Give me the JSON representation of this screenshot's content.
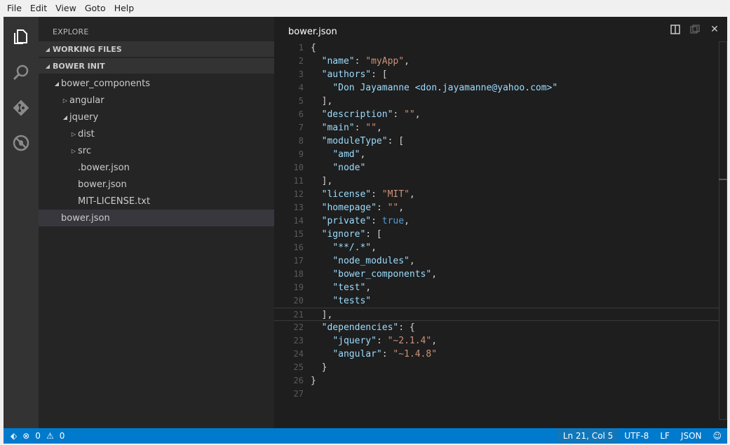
{
  "menu": [
    "File",
    "Edit",
    "View",
    "Goto",
    "Help"
  ],
  "activity": [
    {
      "icon": "files-icon"
    },
    {
      "icon": "search-icon"
    },
    {
      "icon": "git-icon"
    },
    {
      "icon": "debug-icon"
    }
  ],
  "sidebar": {
    "title": "EXPLORE",
    "sections": [
      "WORKING FILES",
      "BOWER INIT"
    ],
    "tree": [
      {
        "label": "bower_components",
        "twisty": "open"
      },
      {
        "label": "angular",
        "twisty": "closed"
      },
      {
        "label": "jquery",
        "twisty": "open"
      },
      {
        "label": "dist",
        "twisty": "closed"
      },
      {
        "label": "src",
        "twisty": "closed"
      },
      {
        "label": ".bower.json",
        "twisty": ""
      },
      {
        "label": "bower.json",
        "twisty": ""
      },
      {
        "label": "MIT-LICENSE.txt",
        "twisty": ""
      },
      {
        "label": "bower.json",
        "twisty": "",
        "selected": true
      }
    ]
  },
  "editor": {
    "title": "bower.json",
    "current_line": 21,
    "lines": [
      [
        [
          "p",
          "{"
        ]
      ],
      [
        [
          "p",
          "  "
        ],
        [
          "k",
          "\"name\""
        ],
        [
          "p",
          ": "
        ],
        [
          "s",
          "\"myApp\""
        ],
        [
          "p",
          ","
        ]
      ],
      [
        [
          "p",
          "  "
        ],
        [
          "k",
          "\"authors\""
        ],
        [
          "p",
          ": ["
        ]
      ],
      [
        [
          "p",
          "    "
        ],
        [
          "k",
          "\"Don Jayamanne <don.jayamanne@yahoo.com>\""
        ]
      ],
      [
        [
          "p",
          "  ],"
        ]
      ],
      [
        [
          "p",
          "  "
        ],
        [
          "k",
          "\"description\""
        ],
        [
          "p",
          ": "
        ],
        [
          "s",
          "\"\""
        ],
        [
          "p",
          ","
        ]
      ],
      [
        [
          "p",
          "  "
        ],
        [
          "k",
          "\"main\""
        ],
        [
          "p",
          ": "
        ],
        [
          "s",
          "\"\""
        ],
        [
          "p",
          ","
        ]
      ],
      [
        [
          "p",
          "  "
        ],
        [
          "k",
          "\"moduleType\""
        ],
        [
          "p",
          ": ["
        ]
      ],
      [
        [
          "p",
          "    "
        ],
        [
          "k",
          "\"amd\""
        ],
        [
          "p",
          ","
        ]
      ],
      [
        [
          "p",
          "    "
        ],
        [
          "k",
          "\"node\""
        ]
      ],
      [
        [
          "p",
          "  ],"
        ]
      ],
      [
        [
          "p",
          "  "
        ],
        [
          "k",
          "\"license\""
        ],
        [
          "p",
          ": "
        ],
        [
          "s",
          "\"MIT\""
        ],
        [
          "p",
          ","
        ]
      ],
      [
        [
          "p",
          "  "
        ],
        [
          "k",
          "\"homepage\""
        ],
        [
          "p",
          ": "
        ],
        [
          "s",
          "\"\""
        ],
        [
          "p",
          ","
        ]
      ],
      [
        [
          "p",
          "  "
        ],
        [
          "k",
          "\"private\""
        ],
        [
          "p",
          ": "
        ],
        [
          "b",
          "true"
        ],
        [
          "p",
          ","
        ]
      ],
      [
        [
          "p",
          "  "
        ],
        [
          "k",
          "\"ignore\""
        ],
        [
          "p",
          ": ["
        ]
      ],
      [
        [
          "p",
          "    "
        ],
        [
          "k",
          "\"**/.*\""
        ],
        [
          "p",
          ","
        ]
      ],
      [
        [
          "p",
          "    "
        ],
        [
          "k",
          "\"node_modules\""
        ],
        [
          "p",
          ","
        ]
      ],
      [
        [
          "p",
          "    "
        ],
        [
          "k",
          "\"bower_components\""
        ],
        [
          "p",
          ","
        ]
      ],
      [
        [
          "p",
          "    "
        ],
        [
          "k",
          "\"test\""
        ],
        [
          "p",
          ","
        ]
      ],
      [
        [
          "p",
          "    "
        ],
        [
          "k",
          "\"tests\""
        ]
      ],
      [
        [
          "p",
          "  ],"
        ]
      ],
      [
        [
          "p",
          "  "
        ],
        [
          "k",
          "\"dependencies\""
        ],
        [
          "p",
          ": {"
        ]
      ],
      [
        [
          "p",
          "    "
        ],
        [
          "k",
          "\"jquery\""
        ],
        [
          "p",
          ": "
        ],
        [
          "s",
          "\"~2.1.4\""
        ],
        [
          "p",
          ","
        ]
      ],
      [
        [
          "p",
          "    "
        ],
        [
          "k",
          "\"angular\""
        ],
        [
          "p",
          ": "
        ],
        [
          "s",
          "\"~1.4.8\""
        ]
      ],
      [
        [
          "p",
          "  }"
        ]
      ],
      [
        [
          "p",
          "}"
        ]
      ],
      [
        [
          "p",
          ""
        ]
      ]
    ]
  },
  "status": {
    "errors": "0",
    "warnings": "0",
    "position": "Ln 21, Col 5",
    "encoding": "UTF-8",
    "eol": "LF",
    "language": "JSON"
  },
  "colors": {
    "statusbar": "#007acc",
    "key": "#9cdcfe",
    "string": "#ce9178",
    "boolean": "#569cd6"
  }
}
